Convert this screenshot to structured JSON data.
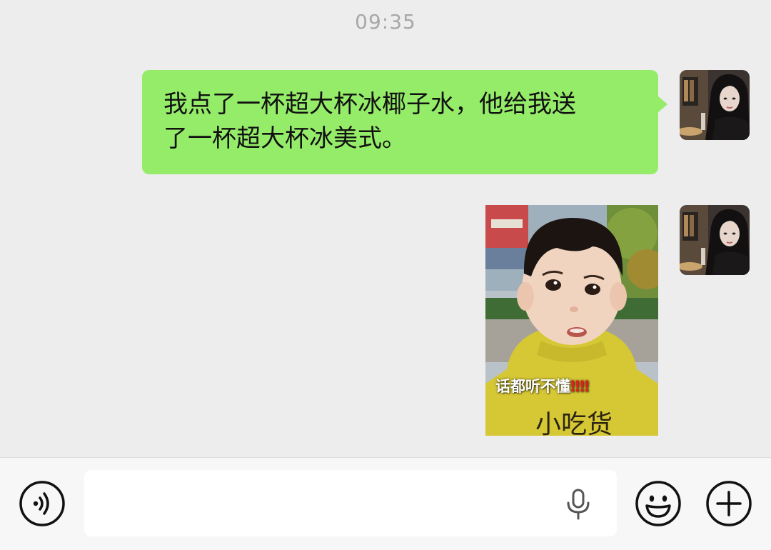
{
  "chat": {
    "timestamp": "09:35",
    "messages": [
      {
        "type": "text",
        "sender": "self",
        "lines": [
          "我点了一杯超大杯冰椰子水，他给我送",
          "了一杯超大杯冰美式。"
        ]
      },
      {
        "type": "sticker",
        "sender": "self",
        "caption": "话都听不懂",
        "caption_marks": "‼‼",
        "shirt_text": "小吃货"
      }
    ]
  },
  "input_bar": {
    "voice_icon": "voice-mode-icon",
    "text_value": "",
    "mic_icon": "microphone-icon",
    "emoji_icon": "emoji-icon",
    "more_icon": "plus-icon"
  },
  "colors": {
    "bubble_self": "#95ec69",
    "chat_background": "#ededed",
    "input_bar_background": "#f7f7f7"
  }
}
